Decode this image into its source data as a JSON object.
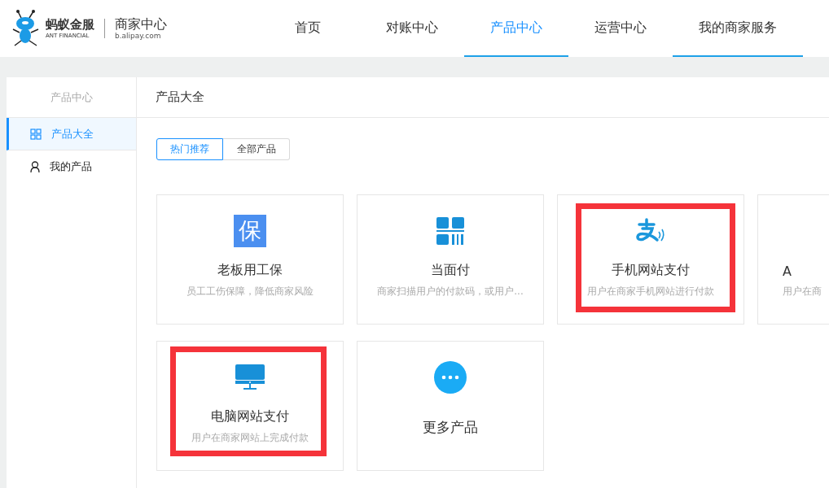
{
  "logo": {
    "brand": "蚂蚁金服",
    "brand_en": "ANT FINANCIAL",
    "product": "商家中心",
    "domain": "b.alipay.com"
  },
  "nav": [
    {
      "label": "首页",
      "selected": false,
      "underlined": false
    },
    {
      "label": "对账中心",
      "selected": false,
      "underlined": false
    },
    {
      "label": "产品中心",
      "selected": true,
      "underlined": true
    },
    {
      "label": "运营中心",
      "selected": false,
      "underlined": false
    },
    {
      "label": "我的商家服务",
      "selected": false,
      "underlined": true
    }
  ],
  "sidebar": {
    "title": "产品中心",
    "items": [
      {
        "label": "产品大全",
        "kind": "grid",
        "selected": true
      },
      {
        "label": "我的产品",
        "kind": "person",
        "selected": false
      }
    ]
  },
  "main": {
    "title": "产品大全",
    "tabs": [
      {
        "label": "热门推荐",
        "selected": true
      },
      {
        "label": "全部产品",
        "selected": false
      }
    ],
    "cards": [
      {
        "kind": "shield",
        "icon_text": "保",
        "title": "老板用工保",
        "desc": "员工工伤保障，降低商家风险",
        "highlighted": false
      },
      {
        "kind": "qr",
        "title": "当面付",
        "desc": "商家扫描用户的付款码，或用户...",
        "highlighted": false
      },
      {
        "kind": "alipay",
        "title": "手机网站支付",
        "desc": "用户在商家手机网站进行付款",
        "highlighted": true
      },
      {
        "kind": "cut",
        "title": "A",
        "desc": "用户在商",
        "highlighted": false
      },
      {
        "kind": "monitor",
        "title": "电脑网站支付",
        "desc": "用户在商家网站上完成付款",
        "highlighted": true
      },
      {
        "kind": "more",
        "title": "更多产品",
        "highlighted": false
      }
    ]
  }
}
